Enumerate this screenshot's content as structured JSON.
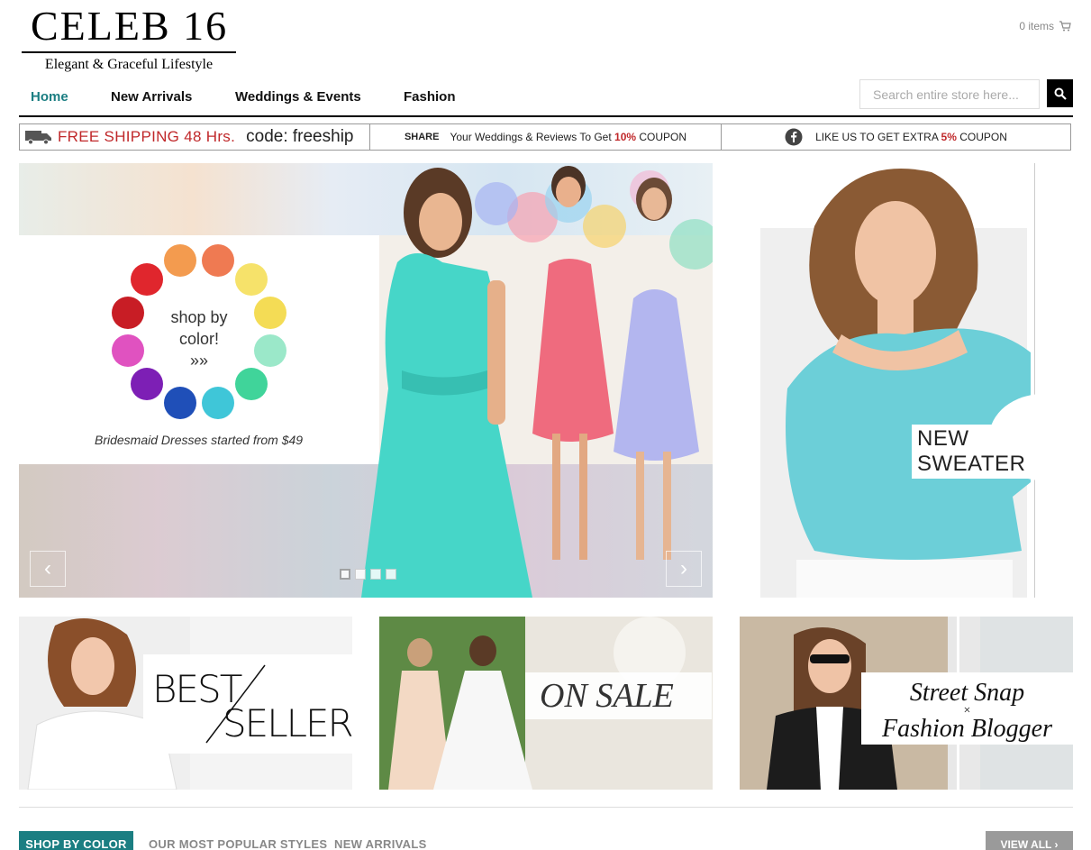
{
  "brand": {
    "name": "CELEB 16",
    "tagline": "Elegant & Graceful Lifestyle"
  },
  "cart": {
    "label": "0 items",
    "icon": "cart-icon"
  },
  "nav": {
    "items": [
      {
        "label": "Home",
        "active": true
      },
      {
        "label": "New Arrivals"
      },
      {
        "label": "Weddings & Events"
      },
      {
        "label": "Fashion"
      }
    ],
    "search_placeholder": "Search entire store here...",
    "search_icon": "search-icon"
  },
  "promo": {
    "shipping_text": "FREE SHIPPING 48 Hrs.",
    "shipping_code": "code: freeship",
    "share_label": "SHARE",
    "share_text": "Your Weddings & Reviews To Get",
    "share_percent": "10%",
    "share_suffix": "COUPON",
    "like_text": "LIKE US TO GET EXTRA",
    "like_percent": "5%",
    "like_suffix": "COUPON"
  },
  "hero": {
    "wheel_line1": "shop by",
    "wheel_line2": "color!",
    "wheel_line3": "»»",
    "caption": "Bridesmaid Dresses started from $49",
    "prev_label": "‹",
    "next_label": "›",
    "wheel_colors": [
      "#ef7a52",
      "#f6e26a",
      "#f4dc55",
      "#9be8c9",
      "#40d49a",
      "#3fc6d8",
      "#1f4fb8",
      "#7d1fb5",
      "#e052c0",
      "#c81d25",
      "#e0262d",
      "#f39b4f"
    ]
  },
  "side_banner": {
    "label": "NEW SWEATER"
  },
  "tiles": {
    "best_line1": "BEST",
    "best_line2": "SELLERS",
    "sale": "ON SALE",
    "street_line1": "Street Snap",
    "street_sep": "×",
    "street_line2": "Fashion Blogger"
  },
  "tabs": {
    "active": "SHOP BY COLOR",
    "popular": "OUR MOST POPULAR STYLES",
    "new": "NEW ARRIVALS",
    "view_all": "VIEW ALL"
  },
  "colors": {
    "accent": "#1b7e82",
    "promo_red": "#c0282a",
    "dress_teal": "#46d6c8",
    "dress_pink": "#ef6b7e",
    "dress_lavender": "#b3b6ef",
    "sweater": "#6ccfd8"
  }
}
